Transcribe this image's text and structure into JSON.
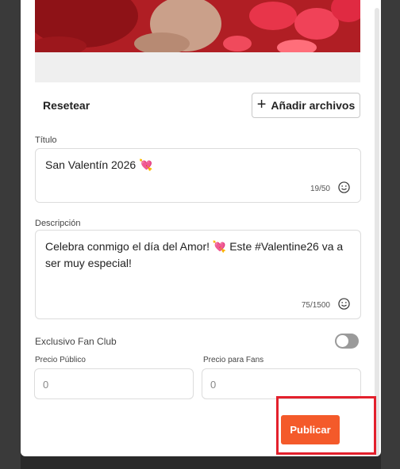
{
  "actions": {
    "reset_label": "Resetear",
    "add_files_label": "Añadir archivos",
    "add_files_icon": "plus-icon"
  },
  "title_field": {
    "label": "Título",
    "value": "San Valentín 2026 💘",
    "counter": "19/50",
    "emoji_icon": "smiley-icon"
  },
  "description_field": {
    "label": "Descripción",
    "value": "Celebra conmigo el día del Amor! 💘 Este #Valentine26 va a ser muy especial!",
    "counter": "75/1500",
    "emoji_icon": "smiley-icon"
  },
  "exclusive": {
    "label": "Exclusivo Fan Club",
    "enabled": false
  },
  "pricing": {
    "public_label": "Precio Público",
    "public_value": "0",
    "fans_label": "Precio para Fans",
    "fans_value": "0"
  },
  "publish_label": "Publicar",
  "colors": {
    "accent": "#f45a2a",
    "highlight": "#e3202c",
    "toggle_off": "#9a9a9a"
  }
}
